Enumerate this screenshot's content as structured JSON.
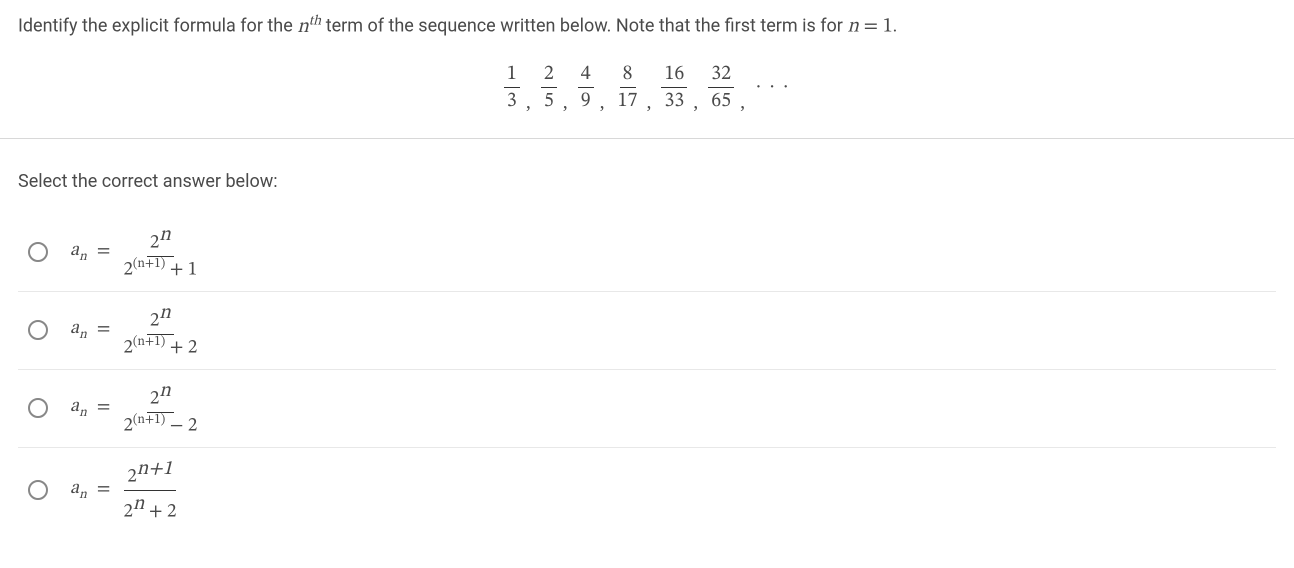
{
  "question_pre": "Identify the explicit formula for the ",
  "nth_base": "n",
  "nth_sup": "th",
  "question_mid": " term of the sequence written below. Note that the first term is for ",
  "var_n": "n",
  "equals": " = ",
  "one": "1",
  "period": ".",
  "sequence": [
    {
      "num": "1",
      "den": "3"
    },
    {
      "num": "2",
      "den": "5"
    },
    {
      "num": "4",
      "den": "9"
    },
    {
      "num": "8",
      "den": "17"
    },
    {
      "num": "16",
      "den": "33"
    },
    {
      "num": "32",
      "den": "65"
    }
  ],
  "comma": ",",
  "dots": "· · ·",
  "prompt": "Select the correct answer below:",
  "an_label_a": "a",
  "an_label_n": "n",
  "eq_sym": "=",
  "options": [
    {
      "num_base": "2",
      "num_exp": "n",
      "den_base": "2",
      "den_exp": "(n+1)",
      "den_tail": " + 1"
    },
    {
      "num_base": "2",
      "num_exp": "n",
      "den_base": "2",
      "den_exp": "(n+1)",
      "den_tail": " + 2"
    },
    {
      "num_base": "2",
      "num_exp": "n",
      "den_base": "2",
      "den_exp": "(n+1)",
      "den_tail": " − 2"
    },
    {
      "num_base": "2",
      "num_exp": "n+1",
      "den_base": "2",
      "den_exp": "n",
      "den_tail": " + 2"
    }
  ]
}
